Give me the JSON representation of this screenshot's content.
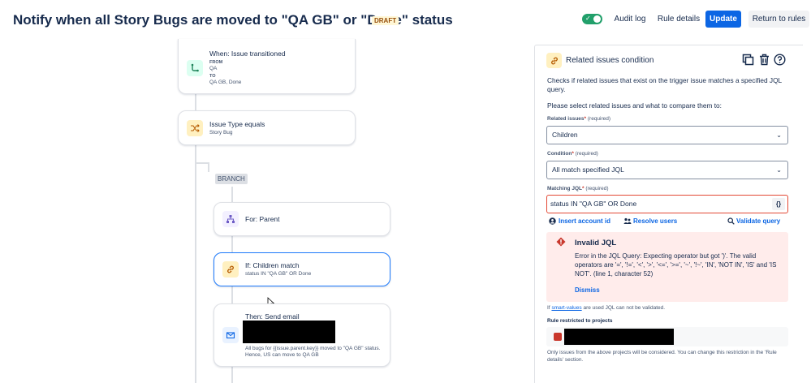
{
  "header": {
    "title": "Notify when all Story Bugs are moved to \"QA GB\" or \"Done\" status",
    "status_lozenge": "DRAFT",
    "toggle_on": true,
    "buttons": {
      "audit_log": "Audit log",
      "rule_details": "Rule details",
      "update": "Update",
      "return": "Return to rules"
    }
  },
  "flow": {
    "trigger": {
      "title": "When: Issue transitioned",
      "from_label": "FROM",
      "from_value": "QA",
      "to_label": "TO",
      "to_value": "QA GB, Done",
      "icon": "transition-icon"
    },
    "condition": {
      "title": "Issue Type equals",
      "subtitle": "Story Bug",
      "icon": "shuffle-icon"
    },
    "branch_label": "BRANCH",
    "branch_for": {
      "title": "For: Parent",
      "icon": "hierarchy-icon"
    },
    "if_children": {
      "title": "If: Children match",
      "subtitle": "status IN \"QA GB\" OR Done",
      "icon": "link-icon"
    },
    "send_email": {
      "title": "Then: Send email",
      "body_line1": "All bugs for {{issue.parent.key}} moved to \"QA GB\" status.",
      "body_line2": "Hence, US can move to QA GB",
      "icon": "mail-icon"
    }
  },
  "panel": {
    "title": "Related issues condition",
    "description": "Checks if related issues that exist on the trigger issue matches a specified JQL query.",
    "instruction": "Please select related issues and what to compare them to:",
    "related_issues": {
      "label": "Related issues",
      "required": "(required)",
      "value": "Children"
    },
    "condition": {
      "label": "Condition",
      "required": "(required)",
      "value": "All match specified JQL"
    },
    "matching_jql": {
      "label": "Matching JQL",
      "required": "(required)",
      "value": "status IN \"QA GB\" OR Done",
      "braces": "{}"
    },
    "actions": {
      "insert_account_id": "Insert account id",
      "resolve_users": "Resolve users",
      "validate_query": "Validate query"
    },
    "error": {
      "title": "Invalid JQL",
      "body": "Error in the JQL Query: Expecting operator but got ')'. The valid operators are '=', '!=', '<', '>', '<=', '>=', '~', '!~', 'IN', 'NOT IN', 'IS' and 'IS NOT'. (line 1, character 52)",
      "dismiss": "Dismiss"
    },
    "smart_note_prefix": "If",
    "smart_note_link": "smart-values",
    "smart_note_suffix": "are used JQL can not be validated.",
    "restricted_label": "Rule restricted to projects",
    "restricted_note": "Only issues from the above projects will be considered. You can change this restriction in the 'Rule details' section."
  },
  "colors": {
    "primary": "#0c66e4",
    "toggle": "#22a06b",
    "error_bg": "#ffeceb",
    "error_border": "#e34935",
    "selected_border": "#1d7afc"
  }
}
